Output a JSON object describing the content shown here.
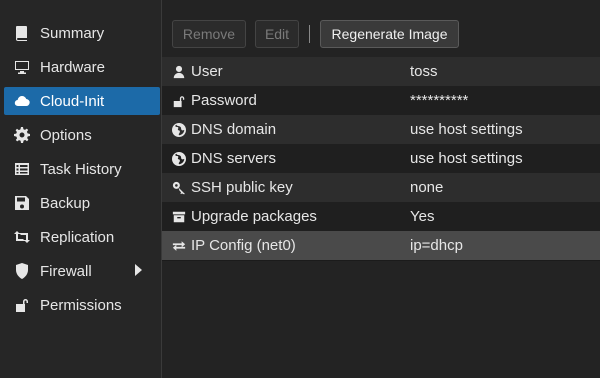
{
  "sidebar": {
    "items": [
      {
        "label": "Summary",
        "icon": "book-icon"
      },
      {
        "label": "Hardware",
        "icon": "monitor-icon"
      },
      {
        "label": "Cloud-Init",
        "icon": "cloud-icon"
      },
      {
        "label": "Options",
        "icon": "gear-icon"
      },
      {
        "label": "Task History",
        "icon": "list-icon"
      },
      {
        "label": "Backup",
        "icon": "floppy-icon"
      },
      {
        "label": "Replication",
        "icon": "retweet-icon"
      },
      {
        "label": "Firewall",
        "icon": "shield-icon"
      },
      {
        "label": "Permissions",
        "icon": "unlock-icon"
      }
    ],
    "active_index": 2
  },
  "toolbar": {
    "remove_label": "Remove",
    "edit_label": "Edit",
    "regenerate_label": "Regenerate Image"
  },
  "table": {
    "rows": [
      {
        "key": "User",
        "value": "toss",
        "icon": "user-icon"
      },
      {
        "key": "Password",
        "value": "**********",
        "icon": "unlock-icon"
      },
      {
        "key": "DNS domain",
        "value": "use host settings",
        "icon": "globe-icon"
      },
      {
        "key": "DNS servers",
        "value": "use host settings",
        "icon": "globe-icon"
      },
      {
        "key": "SSH public key",
        "value": "none",
        "icon": "key-icon"
      },
      {
        "key": "Upgrade packages",
        "value": "Yes",
        "icon": "archive-icon"
      },
      {
        "key": "IP Config (net0)",
        "value": "ip=dhcp",
        "icon": "exchange-icon"
      }
    ],
    "selected_index": 6
  }
}
